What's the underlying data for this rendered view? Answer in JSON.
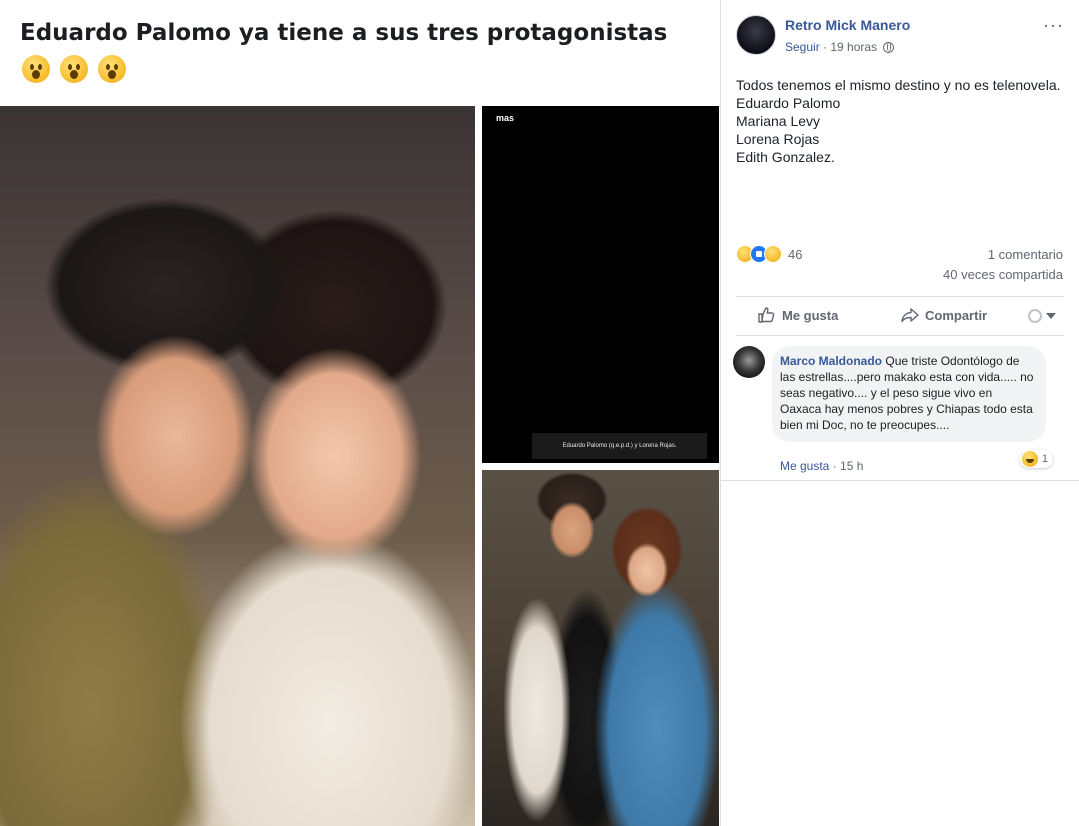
{
  "headline": {
    "text": "Eduardo Palomo ya tiene a sus tres protagonistas",
    "emoji_names": [
      "wow-emoji",
      "wow-emoji",
      "wow-emoji"
    ]
  },
  "photos": {
    "top_caption": "Eduardo Palomo (q.e.p.d.) y Lorena Rojas.",
    "top_logo": "mas"
  },
  "post": {
    "author": "Retro Mick Manero",
    "follow_label": "Seguir",
    "separator": "·",
    "time": "19 horas",
    "lines": [
      "Todos tenemos el mismo destino y no es telenovela.",
      "Eduardo Palomo",
      "Mariana Levy",
      "Lorena Rojas",
      "Edith Gonzalez."
    ],
    "reaction_count": "46",
    "comments_count": "1 comentario",
    "shares_count": "40 veces compartida",
    "more_label": "···"
  },
  "actions": {
    "like_label": "Me gusta",
    "share_label": "Compartir"
  },
  "comment": {
    "author": "Marco Maldonado",
    "text": "Que triste Odontólogo de las estrellas....pero makako esta con vida..... no seas negativo.... y el peso sigue vivo en Oaxaca hay menos pobres y Chiapas todo esta bien mi Doc, no te preocupes....",
    "reaction_count": "1",
    "like_label": "Me gusta",
    "separator": "·",
    "time": "15 h"
  },
  "colors": {
    "link_blue": "#385898",
    "muted_gray": "#616770",
    "like_blue": "#2078f4",
    "emoji_yellow": "#f7b928"
  }
}
